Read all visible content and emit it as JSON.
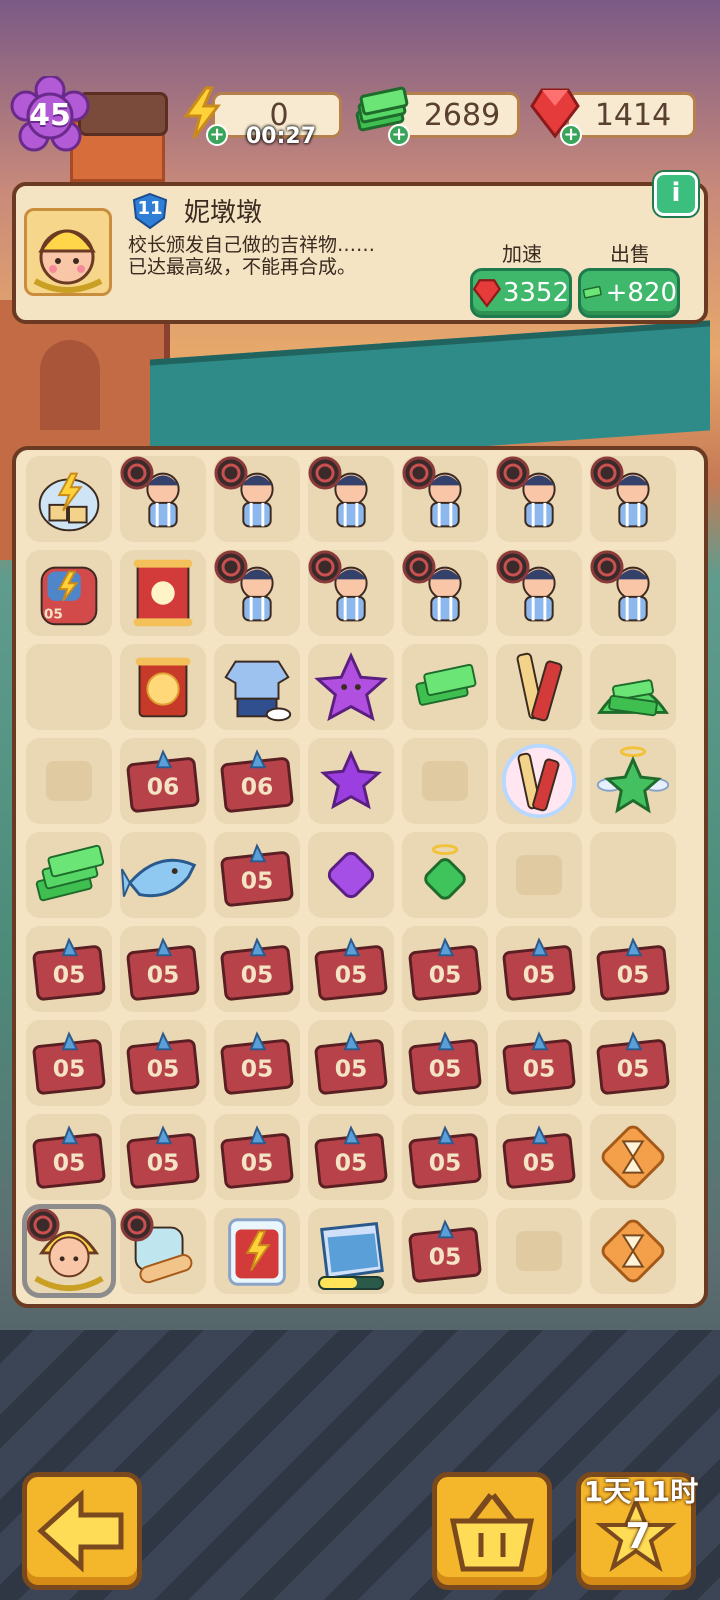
{
  "header": {
    "level": "45",
    "energy": {
      "value": "0",
      "timer": "00:27",
      "icon": "lightning-icon"
    },
    "cash": {
      "value": "2689",
      "icon": "cash-stack-icon"
    },
    "gems": {
      "value": "1414",
      "icon": "ruby-gem-icon"
    }
  },
  "info_panel": {
    "item_level": "11",
    "item_name": "妮墩墩",
    "description": "校长颁发自己做的吉祥物……\n已达最高级，不能再合成。",
    "info_icon": "i",
    "speedup_label": "加速",
    "speedup_cost": "3352",
    "sell_label": "出售",
    "sell_value": "+820"
  },
  "board": {
    "rows": 9,
    "cols": 7,
    "cells": [
      [
        "supply-bag",
        "student",
        "student",
        "student",
        "student",
        "student",
        "student"
      ],
      [
        "backpack-05",
        "scroll-red",
        "student",
        "student",
        "student",
        "student",
        "student"
      ],
      [
        "empty",
        "scroll-spark",
        "uniform",
        "star-purple-big",
        "cash-small",
        "snack-stick",
        "cash-pile"
      ],
      [
        "ph",
        "ticket-06",
        "ticket-06",
        "star-purple",
        "ph",
        "snack-rainbow",
        "star-green-angel"
      ],
      [
        "cash-medium",
        "shark",
        "ticket-05",
        "gem-purple",
        "gem-green",
        "ph",
        "empty"
      ],
      [
        "ticket-05",
        "ticket-05",
        "ticket-05",
        "ticket-05",
        "ticket-05",
        "ticket-05",
        "ticket-05"
      ],
      [
        "ticket-05",
        "ticket-05",
        "ticket-05",
        "ticket-05",
        "ticket-05",
        "ticket-05",
        "ticket-05"
      ],
      [
        "ticket-05",
        "ticket-05",
        "ticket-05",
        "ticket-05",
        "ticket-05",
        "ticket-05",
        "hourglass"
      ],
      [
        "mascot",
        "bandage-box",
        "energy-jar",
        "folder",
        "ticket-05",
        "ph",
        "hourglass"
      ]
    ],
    "ticket_05_label": "05",
    "ticket_06_label": "06",
    "backpack_label": "05",
    "folder_progress": 0.6
  },
  "bottom": {
    "back_icon": "arrow-left-icon",
    "basket_icon": "basket-icon",
    "event_timer": "1天11时",
    "event_count": "7"
  },
  "colors": {
    "panel_bg": "#f4e4c4",
    "panel_border": "#6a3b22",
    "cell_bg": "#ead7b3",
    "green_button": "#40b86c",
    "orange_button": "#f4b62a"
  }
}
